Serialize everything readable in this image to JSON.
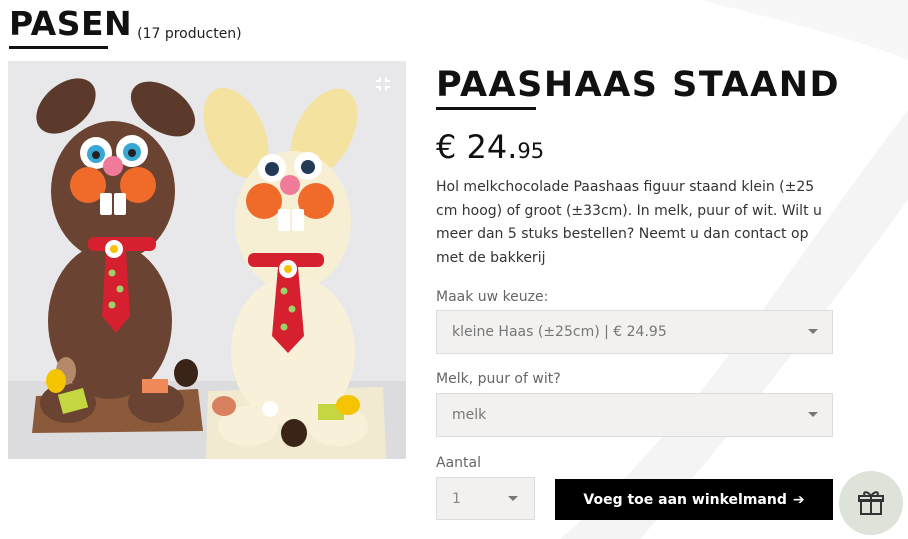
{
  "category": {
    "title": "PASEN",
    "count": "(17 producten)"
  },
  "product": {
    "title": "PAASHAAS STAAND",
    "price_main": "€ 24.",
    "price_cents": "95",
    "description": "Hol melkchocolade Paashaas figuur staand klein (±25 cm hoog) of groot (±33cm). In melk, puur of wit. Wilt u meer dan 5 stuks bestellen? Neemt u dan contact op met de bakkerij"
  },
  "options": {
    "choice_label": "Maak uw keuze:",
    "choice_value": "kleine Haas (±25cm) | € 24.95",
    "type_label": "Melk, puur of wit?",
    "type_value": "melk",
    "qty_label": "Aantal",
    "qty_value": "1"
  },
  "cart": {
    "button_label": "Voeg toe aan winkelmand",
    "arrow": "➔"
  },
  "icons": {
    "expand": "expand-icon",
    "gift": "gift-icon",
    "caret": "chevron-down-icon"
  },
  "colors": {
    "primary": "#000000",
    "select_bg": "#f2f1ef",
    "gift_bg": "#dde3d8"
  }
}
